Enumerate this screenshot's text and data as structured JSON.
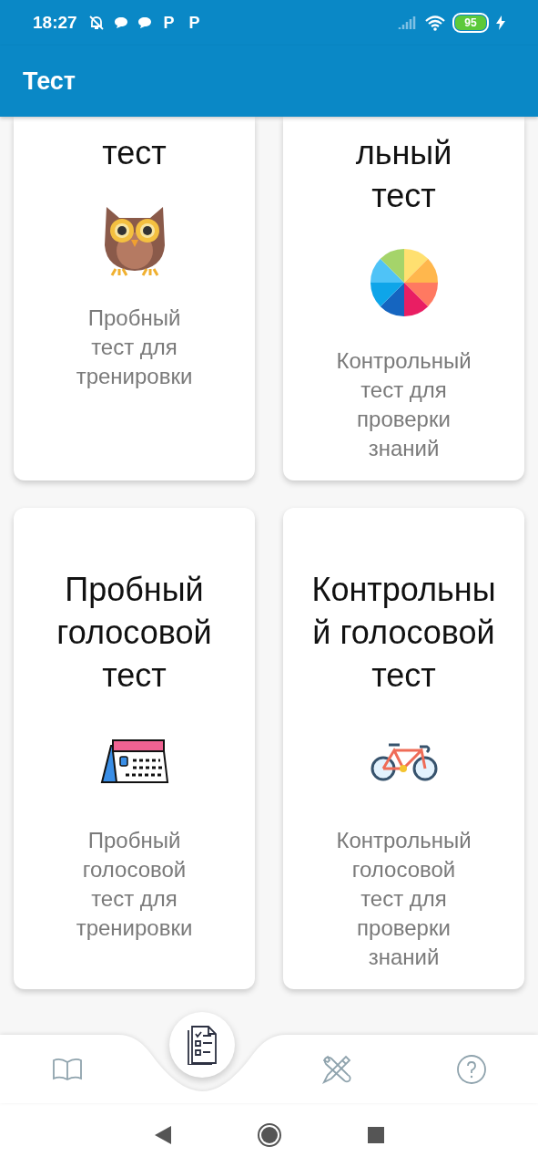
{
  "status_bar": {
    "time": "18:27",
    "app_badges": [
      "P",
      "P"
    ],
    "battery": "95"
  },
  "app_bar": {
    "title": "Тест"
  },
  "cards": [
    {
      "kind": "owl",
      "title_lines": [
        "тест"
      ],
      "description_lines": [
        "Пробный",
        "тест для",
        "тренировки"
      ]
    },
    {
      "kind": "pie",
      "title_lines": [
        "льный",
        "тест"
      ],
      "description_lines": [
        "Контрольный",
        "тест для",
        "проверки",
        "знаний"
      ]
    },
    {
      "kind": "calendar",
      "title_lines": [
        "Пробный",
        "голосовой",
        "тест"
      ],
      "description_lines": [
        "Пробный",
        "голосовой",
        "тест для",
        "тренировки"
      ]
    },
    {
      "kind": "bicycle",
      "title_lines": [
        "Контрольны",
        "й голосовой",
        "тест"
      ],
      "description_lines": [
        "Контрольный",
        "голосовой",
        "тест для",
        "проверки",
        "знаний"
      ]
    }
  ],
  "bottom_nav": [
    {
      "kind": "book",
      "selected": false
    },
    {
      "kind": "checklist",
      "selected": true
    },
    {
      "kind": "tools",
      "selected": false
    },
    {
      "kind": "help",
      "selected": false
    }
  ]
}
